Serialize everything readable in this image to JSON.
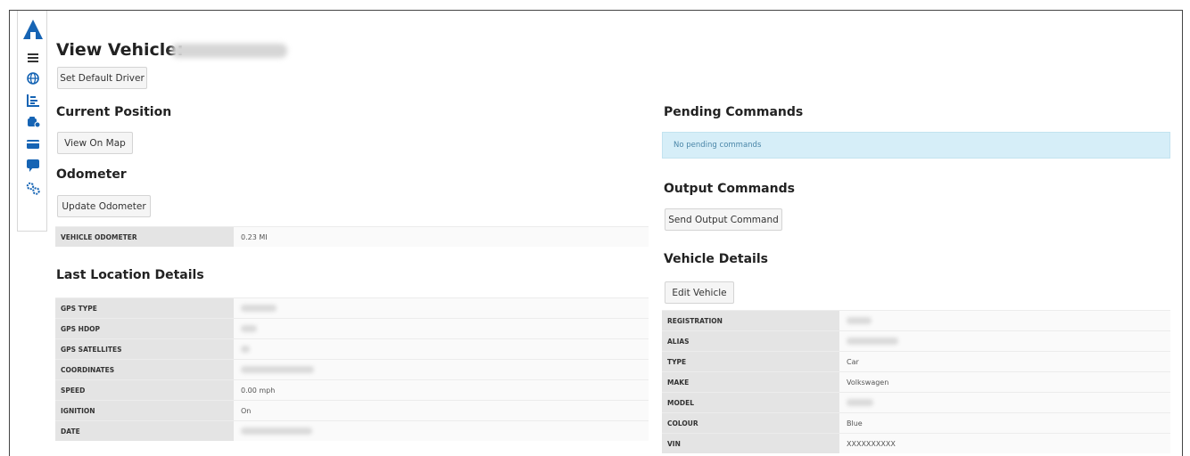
{
  "header": {
    "title": "View Vehicle:",
    "set_default_driver": "Set Default Driver"
  },
  "current_position": {
    "heading": "Current Position",
    "view_on_map": "View On Map"
  },
  "odometer": {
    "heading": "Odometer",
    "update_button": "Update Odometer",
    "rows": [
      {
        "label": "VEHICLE ODOMETER",
        "value": "0.23 MI"
      }
    ]
  },
  "last_location": {
    "heading": "Last Location Details",
    "rows": [
      {
        "label": "GPS TYPE",
        "value": ""
      },
      {
        "label": "GPS HDOP",
        "value": ""
      },
      {
        "label": "GPS SATELLITES",
        "value": ""
      },
      {
        "label": "COORDINATES",
        "value": ""
      },
      {
        "label": "SPEED",
        "value": "0.00 mph"
      },
      {
        "label": "IGNITION",
        "value": "On"
      },
      {
        "label": "DATE",
        "value": ""
      }
    ]
  },
  "pending_commands": {
    "heading": "Pending Commands",
    "empty_text": "No pending commands"
  },
  "output_commands": {
    "heading": "Output Commands",
    "send_button": "Send Output Command"
  },
  "vehicle_details": {
    "heading": "Vehicle Details",
    "edit_button": "Edit Vehicle",
    "rows": [
      {
        "label": "REGISTRATION",
        "value": ""
      },
      {
        "label": "ALIAS",
        "value": ""
      },
      {
        "label": "TYPE",
        "value": "Car"
      },
      {
        "label": "MAKE",
        "value": "Volkswagen"
      },
      {
        "label": "MODEL",
        "value": ""
      },
      {
        "label": "COLOUR",
        "value": "Blue"
      },
      {
        "label": "VIN",
        "value": "XXXXXXXXXX"
      }
    ]
  },
  "sidebar": {
    "icons": [
      "logo-icon",
      "menu-icon",
      "globe-icon",
      "list-chart-icon",
      "vehicle-settings-icon",
      "card-icon",
      "chat-icon",
      "gears-icon"
    ]
  },
  "colors": {
    "brand": "#1664b4",
    "pending_bg": "#d6eef8",
    "label_bg": "#e4e4e4"
  }
}
